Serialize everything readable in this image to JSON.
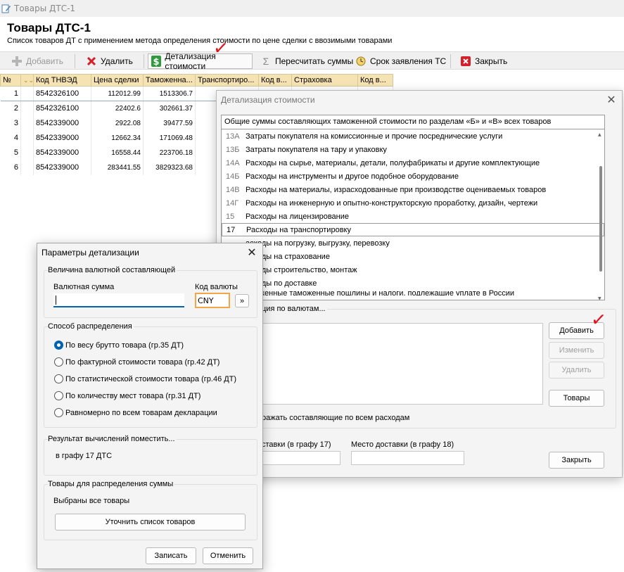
{
  "window": {
    "title": "Товары ДТС-1",
    "icon": "pencil-document-icon"
  },
  "page": {
    "title": "Товары ДТС-1",
    "subtitle": "Список товаров ДТ с применением метода определения стоимости по цене сделки с ввозимыми товарами"
  },
  "toolbar": {
    "add": {
      "label": "Добавить",
      "icon": "plus-icon"
    },
    "delete": {
      "label": "Удалить",
      "icon": "red-x-icon"
    },
    "detail": {
      "label": "Детализация стоимости",
      "icon": "dollar-icon"
    },
    "recalc": {
      "label": "Пересчитать суммы",
      "icon": "sigma-icon"
    },
    "deadline": {
      "label": "Срок заявления ТС",
      "icon": "clock-icon"
    },
    "close": {
      "label": "Закрыть",
      "icon": "red-close-icon"
    }
  },
  "table": {
    "headers": [
      "№",
      "",
      "Код ТНВЭД",
      "Цена сделки",
      "Таможенна...",
      "Транспортиро...",
      "Код в...",
      "Страховка",
      "Код в..."
    ],
    "rows": [
      {
        "n": "1",
        "code": "8542326100",
        "price": "112012.99",
        "customs": "1513306.7"
      },
      {
        "n": "2",
        "code": "8542326100",
        "price": "22402.6",
        "customs": "302661.37"
      },
      {
        "n": "3",
        "code": "8542339000",
        "price": "2922.08",
        "customs": "39477.59"
      },
      {
        "n": "4",
        "code": "8542339000",
        "price": "12662.34",
        "customs": "171069.48"
      },
      {
        "n": "5",
        "code": "8542339000",
        "price": "16558.44",
        "customs": "223706.18"
      },
      {
        "n": "6",
        "code": "8542339000",
        "price": "283441.55",
        "customs": "3829323.68"
      }
    ]
  },
  "detail_dialog": {
    "title": "Детализация стоимости",
    "list_header": "Общие суммы составляющих таможенной стоимости по разделам «Б» и «В» всех товаров",
    "items": [
      {
        "code": "13А",
        "text": "Затраты покупателя на комиссионные и прочие посреднические услуги"
      },
      {
        "code": "13Б",
        "text": "Затраты покупателя на тару и упаковку"
      },
      {
        "code": "14А",
        "text": "Расходы на сырье, материалы, детали, полуфабрикаты и другие комплектующие"
      },
      {
        "code": "14Б",
        "text": "Расходы на инструменты и другое подобное оборудование"
      },
      {
        "code": "14В",
        "text": "Расходы на материалы, израсходованные при производстве оцениваемых товаров"
      },
      {
        "code": "14Г",
        "text": "Расходы на инженерную и опытно-конструкторскую проработку, дизайн, чертежи"
      },
      {
        "code": "15",
        "text": "Расходы на лицензирование"
      },
      {
        "code": "17",
        "text": "Расходы на транспортировку"
      },
      {
        "code": "",
        "text": "асходы на погрузку, выгрузку, перевозку"
      },
      {
        "code": "",
        "text": "асходы на страхование"
      },
      {
        "code": "",
        "text": "асходы строительство, монтаж"
      },
      {
        "code": "",
        "text": "асходы по доставке"
      },
      {
        "code": "",
        "text": "аможенные таможенные пошлины и налоги, подлежащие уплате в России"
      }
    ],
    "currency_group_label": "ция по валютам...",
    "buttons": {
      "add": "Добавить",
      "edit": "Изменить",
      "delete": "Удалить",
      "goods": "Товары",
      "close": "Закрыть"
    },
    "show_all_label": "ражать составляющие по всем расходам",
    "field_left_label": "ставки (в графу 17)",
    "field_right_label": "Место доставки (в графу 18)"
  },
  "params_dialog": {
    "title": "Параметры детализации",
    "currency_group": "Величина валютной составляющей",
    "amount_label": "Валютная сумма",
    "amount_value": "",
    "currency_code_label": "Код валюты",
    "currency_code_value": "CNY",
    "more_button": "»",
    "distribution_group": "Способ распределения",
    "options": [
      {
        "label": "По весу брутто товара (гр.35 ДТ)",
        "selected": true
      },
      {
        "label": "По фактурной стоимости товара (гр.42 ДТ)",
        "selected": false
      },
      {
        "label": "По статистической стоимости товара (гр.46 ДТ)",
        "selected": false
      },
      {
        "label": "По количеству мест товара (гр.31 ДТ)",
        "selected": false
      },
      {
        "label": "Равномерно по всем товарам декларации",
        "selected": false
      }
    ],
    "result_group": "Результат вычислений поместить...",
    "result_value": "в графу 17 ДТС",
    "goods_group": "Товары для распределения суммы",
    "goods_value": "Выбраны все товары",
    "refine_button": "Уточнить список товаров",
    "save_button": "Записать",
    "cancel_button": "Отменить"
  }
}
